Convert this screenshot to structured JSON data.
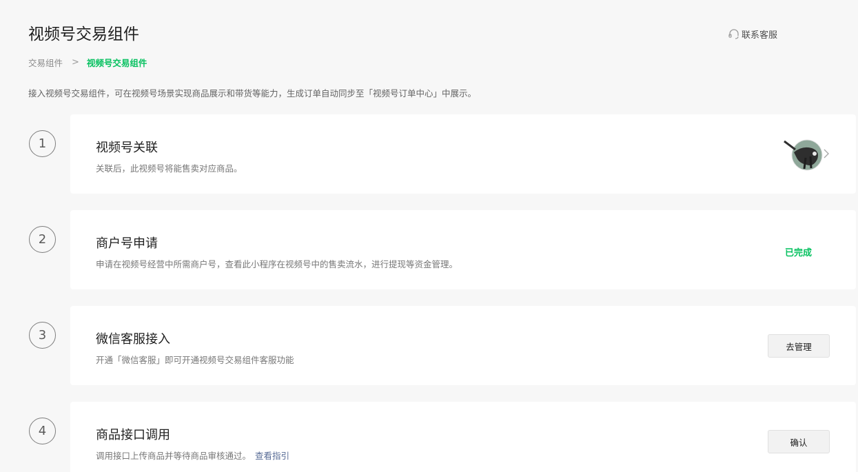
{
  "header": {
    "title": "视频号交易组件",
    "contact_label": "联系客服",
    "contact_icon": "headset-icon"
  },
  "breadcrumb": {
    "parent": "交易组件",
    "separator": ">",
    "current": "视频号交易组件"
  },
  "intro": "接入视频号交易组件，可在视频号场景实现商品展示和带货等能力，生成订单自动同步至「视频号订单中心」中展示。",
  "colors": {
    "accent": "#07c160",
    "link": "#576b95"
  },
  "steps": [
    {
      "number": "1",
      "title": "视频号关联",
      "desc": "关联后，此视频号将能售卖对应商品。",
      "action": "avatar-chevron"
    },
    {
      "number": "2",
      "title": "商户号申请",
      "desc": "申请在视频号经营中所需商户号，查看此小程序在视频号中的售卖流水，进行提现等资金管理。",
      "status": "已完成"
    },
    {
      "number": "3",
      "title": "微信客服接入",
      "desc": "开通「微信客服」即可开通视频号交易组件客服功能",
      "button": "去管理"
    },
    {
      "number": "4",
      "title": "商品接口调用",
      "desc": "调用接口上传商品并等待商品审核通过。",
      "link": "查看指引",
      "button": "确认"
    }
  ]
}
